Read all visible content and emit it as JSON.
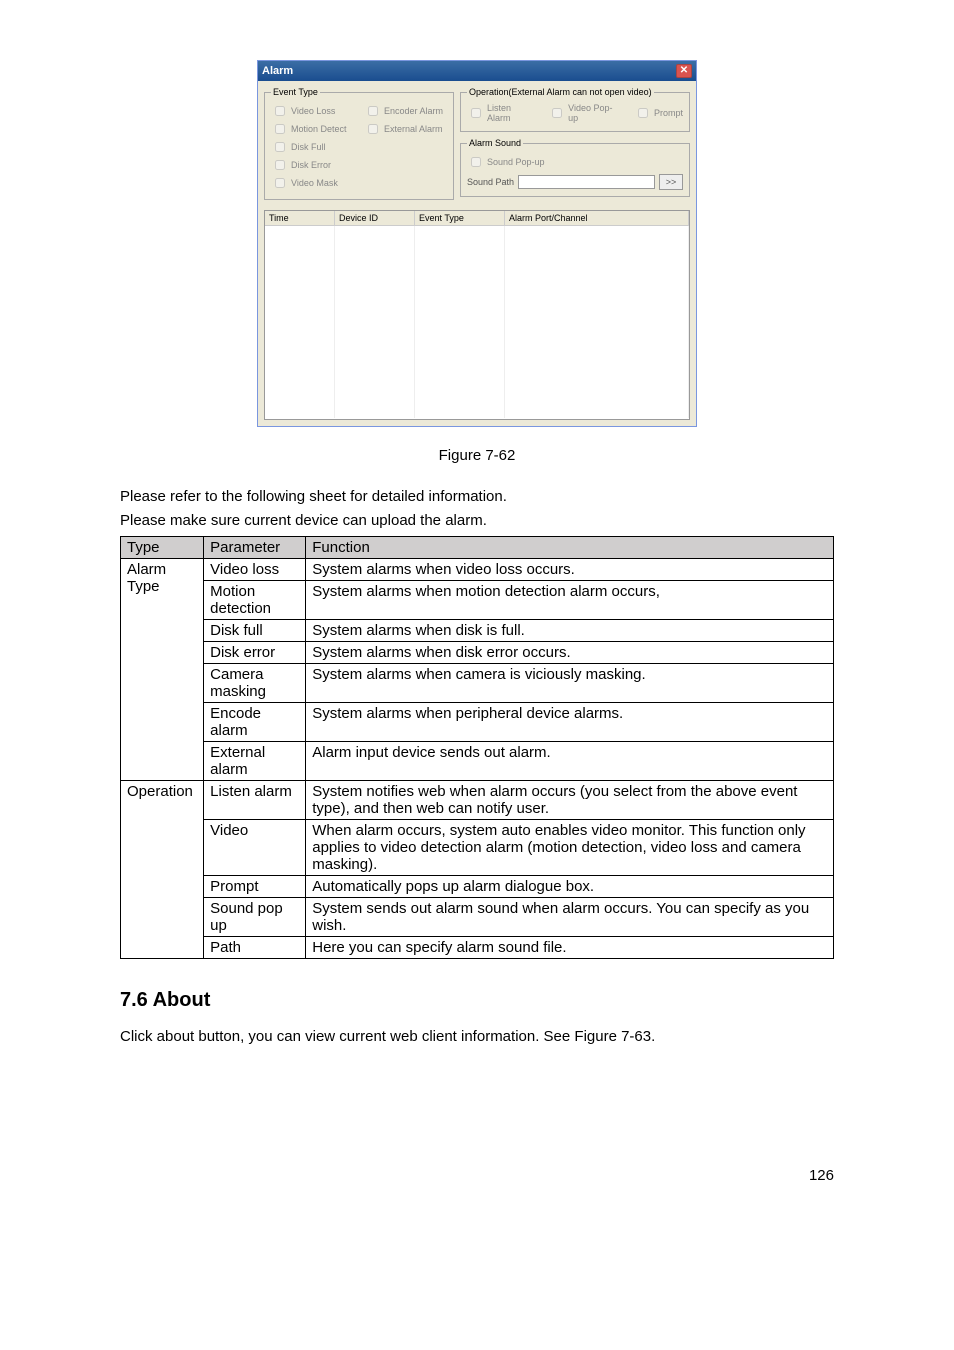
{
  "dialog": {
    "title": "Alarm",
    "close_glyph": "✕",
    "event_type": {
      "legend": "Event Type",
      "left": [
        "Video Loss",
        "Motion Detect",
        "Disk Full",
        "Disk Error",
        "Video Mask"
      ],
      "right": [
        "Encoder Alarm",
        "External Alarm"
      ]
    },
    "operation": {
      "legend": "Operation(External Alarm can not open video)",
      "items": [
        "Listen Alarm",
        "Video Pop-up",
        "Prompt"
      ]
    },
    "alarm_sound": {
      "legend": "Alarm Sound",
      "sound_popup": "Sound Pop-up",
      "path_label": "Sound Path",
      "browse": ">>",
      "path_value": ""
    },
    "grid_headers": [
      "Time",
      "Device ID",
      "Event Type",
      "Alarm Port/Channel"
    ]
  },
  "figure_caption": "Figure 7-62",
  "intro_lines": [
    "Please refer to the following sheet for detailed information.",
    "Please make sure current device can upload the alarm."
  ],
  "table": {
    "head": [
      "Type",
      "Parameter",
      "Function"
    ],
    "groups": [
      {
        "type": "Alarm Type",
        "rows": [
          {
            "param": "Video loss",
            "func": "System alarms when video loss occurs."
          },
          {
            "param": "Motion detection",
            "func": "System alarms when motion detection alarm occurs,"
          },
          {
            "param": "Disk full",
            "func": "System alarms when disk is full."
          },
          {
            "param": "Disk error",
            "func": "System alarms when disk error occurs."
          },
          {
            "param": "Camera masking",
            "func": "System alarms when camera is viciously masking."
          },
          {
            "param": "Encode alarm",
            "func": "System alarms when peripheral device alarms."
          },
          {
            "param": "External alarm",
            "func": "Alarm input device sends out alarm."
          }
        ]
      },
      {
        "type": "Operation",
        "rows": [
          {
            "param": "Listen alarm",
            "func": "System notifies web when alarm occurs (you select from the above event type), and then web can notify user."
          },
          {
            "param": "Video",
            "func": "When alarm occurs, system auto enables video monitor. This function only applies to video detection alarm (motion detection, video loss and camera masking)."
          },
          {
            "param": "Prompt",
            "func": "Automatically pops up alarm dialogue box."
          },
          {
            "param": "Sound pop up",
            "func": "System sends out alarm sound when alarm occurs. You can specify as you wish."
          },
          {
            "param": "Path",
            "func": "Here you can specify alarm sound file."
          }
        ]
      }
    ]
  },
  "section": {
    "heading": "7.6  About",
    "body": "Click about button, you can view current web client information. See Figure 7-63."
  },
  "page_number": "126"
}
